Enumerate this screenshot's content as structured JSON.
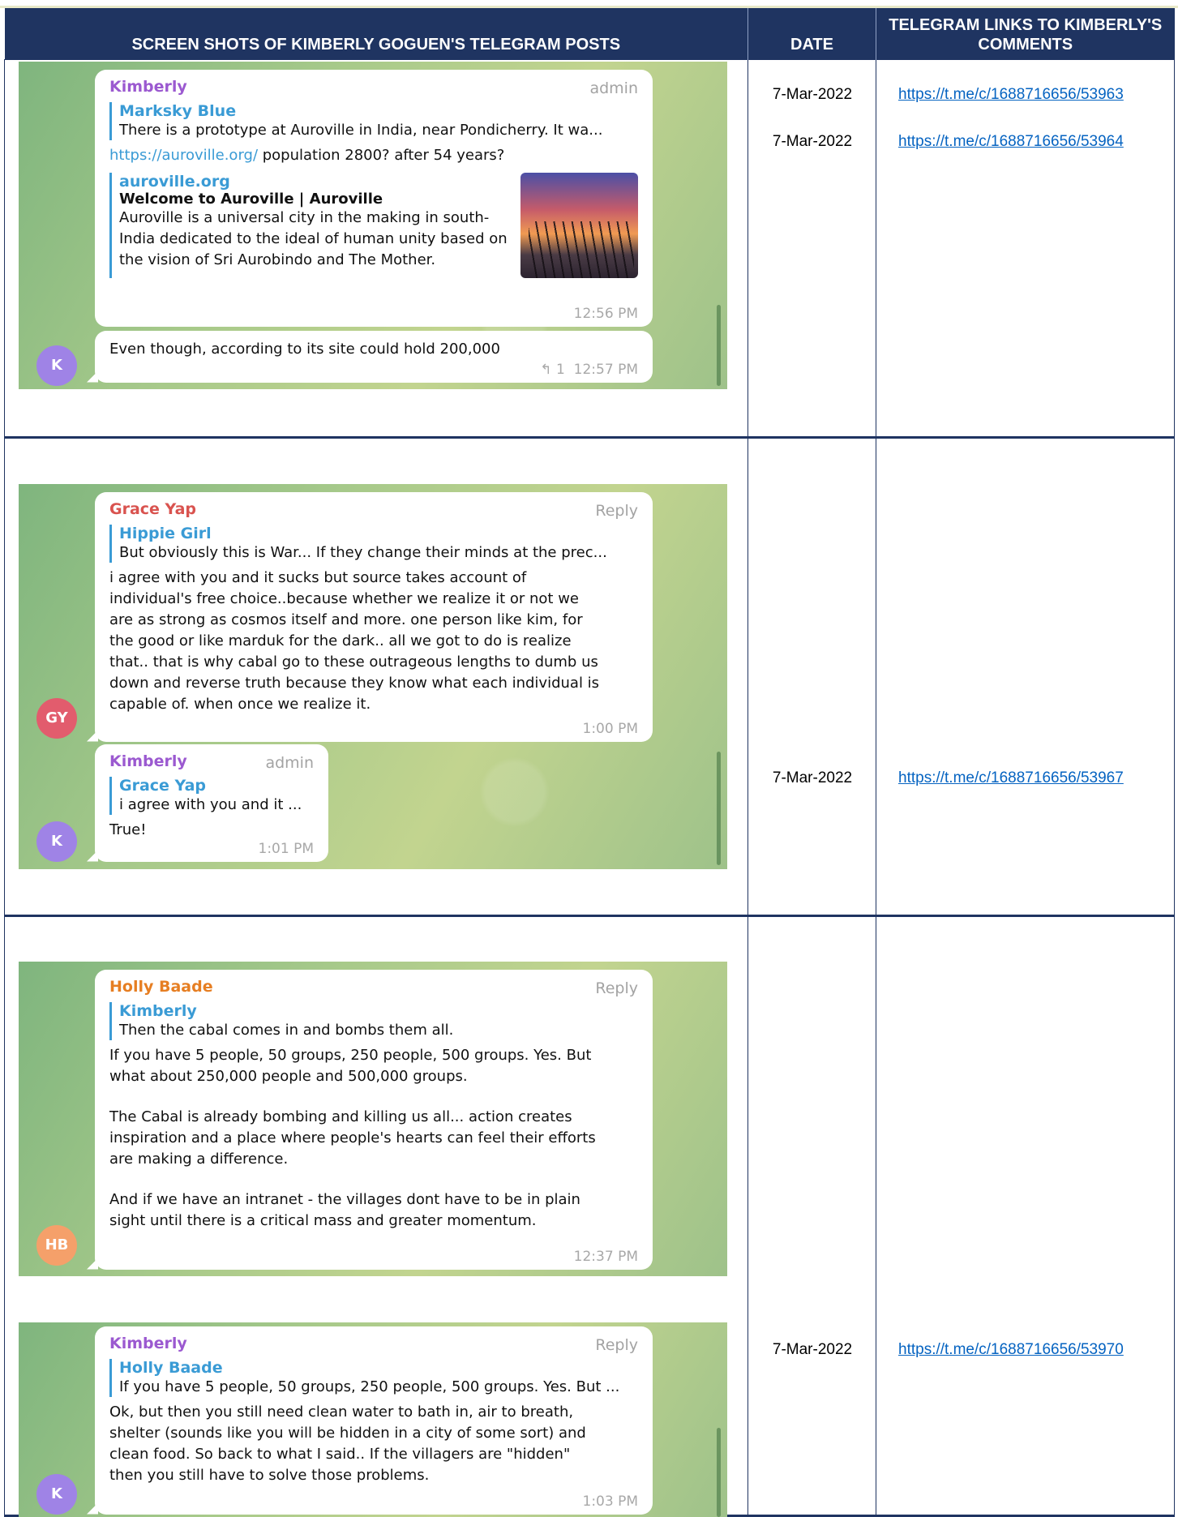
{
  "headers": {
    "col1": "SCREEN SHOTS OF KIMBERLY GOGUEN'S TELEGRAM POSTS",
    "col2": "DATE",
    "col3": "TELEGRAM LINKS TO KIMBERLY'S COMMENTS"
  },
  "rows": [
    {
      "dates": [
        "7-Mar-2022",
        "7-Mar-2022"
      ],
      "links": [
        "https://t.me/c/1688716656/53963",
        "https://t.me/c/1688716656/53964"
      ],
      "messages": [
        {
          "sender": "Kimberly",
          "badge": "admin",
          "quote_name": "Marksky Blue",
          "quote_text": "There is a prototype at Auroville in India, near Pondicherry. It wa...",
          "link": "https://auroville.org/",
          "text": " population 2800? after 54 years?",
          "preview_site": "auroville.org",
          "preview_title": "Welcome to Auroville | Auroville",
          "preview_desc": "Auroville is a universal city in the making in south-India dedicated to the ideal of human unity based on the vision of Sri Aurobindo and The Mother.",
          "time": "12:56 PM"
        },
        {
          "text": "Even though, according to its site could hold 200,000",
          "reply_count": "1",
          "time": "12:57 PM",
          "avatar": "K"
        }
      ]
    },
    {
      "dates": [
        "7-Mar-2022"
      ],
      "links": [
        "https://t.me/c/1688716656/53967"
      ],
      "messages": [
        {
          "sender": "Grace Yap",
          "badge": "Reply",
          "quote_name": "Hippie Girl",
          "quote_text": "But obviously this is War...  If they change their minds at the prec...",
          "text": "i agree with you and it sucks but source takes account of individual's free choice..because whether we realize it or not we are as strong as cosmos itself and more. one person like kim, for the good or like marduk for the dark.. all we got to do is realize that.. that is why cabal go to these outrageous lengths to dumb us down and reverse truth because they know what each individual is capable of. when once we realize it.",
          "time": "1:00 PM",
          "avatar": "GY"
        },
        {
          "sender": "Kimberly",
          "badge": "admin",
          "quote_name": "Grace Yap",
          "quote_text": "i agree with you and it ...",
          "text": "True!",
          "time": "1:01 PM",
          "avatar": "K"
        }
      ]
    },
    {
      "dates": [
        "7-Mar-2022"
      ],
      "links": [
        "https://t.me/c/1688716656/53970"
      ],
      "messages": [
        {
          "sender": "Holly Baade",
          "badge": "Reply",
          "quote_name": "Kimberly",
          "quote_text": "Then the cabal comes in and bombs them all.",
          "text_p1": "If you have 5 people, 50 groups, 250 people, 500 groups. Yes. But what about 250,000 people and 500,000 groups.",
          "text_p2": "The Cabal is already bombing and killing us all... action creates inspiration and a place where people's hearts can feel their efforts are making a difference.",
          "text_p3": "And if we have an intranet - the villages dont have to be in plain sight until there is a critical mass and greater momentum.",
          "time": "12:37 PM",
          "avatar": "HB"
        },
        {
          "sender": "Kimberly",
          "badge": "Reply",
          "quote_name": "Holly Baade",
          "quote_text": "If you have 5 people, 50 groups, 250 people, 500 groups. Yes. But ...",
          "text": "Ok, but then you still need clean water to bath in, air to breath, shelter (sounds like you will be hidden in a city of some sort) and clean food. So back to what I said.. If the villagers are \"hidden\" then you still have to solve those problems.",
          "time": "1:03 PM",
          "avatar": "K"
        }
      ]
    }
  ],
  "colors": {
    "header_bg": "#1f3461",
    "kimberly": "#9b59d0",
    "grace": "#d9534f",
    "holly": "#e67e22",
    "quote": "#3a9bd5",
    "link": "#0563c1"
  }
}
